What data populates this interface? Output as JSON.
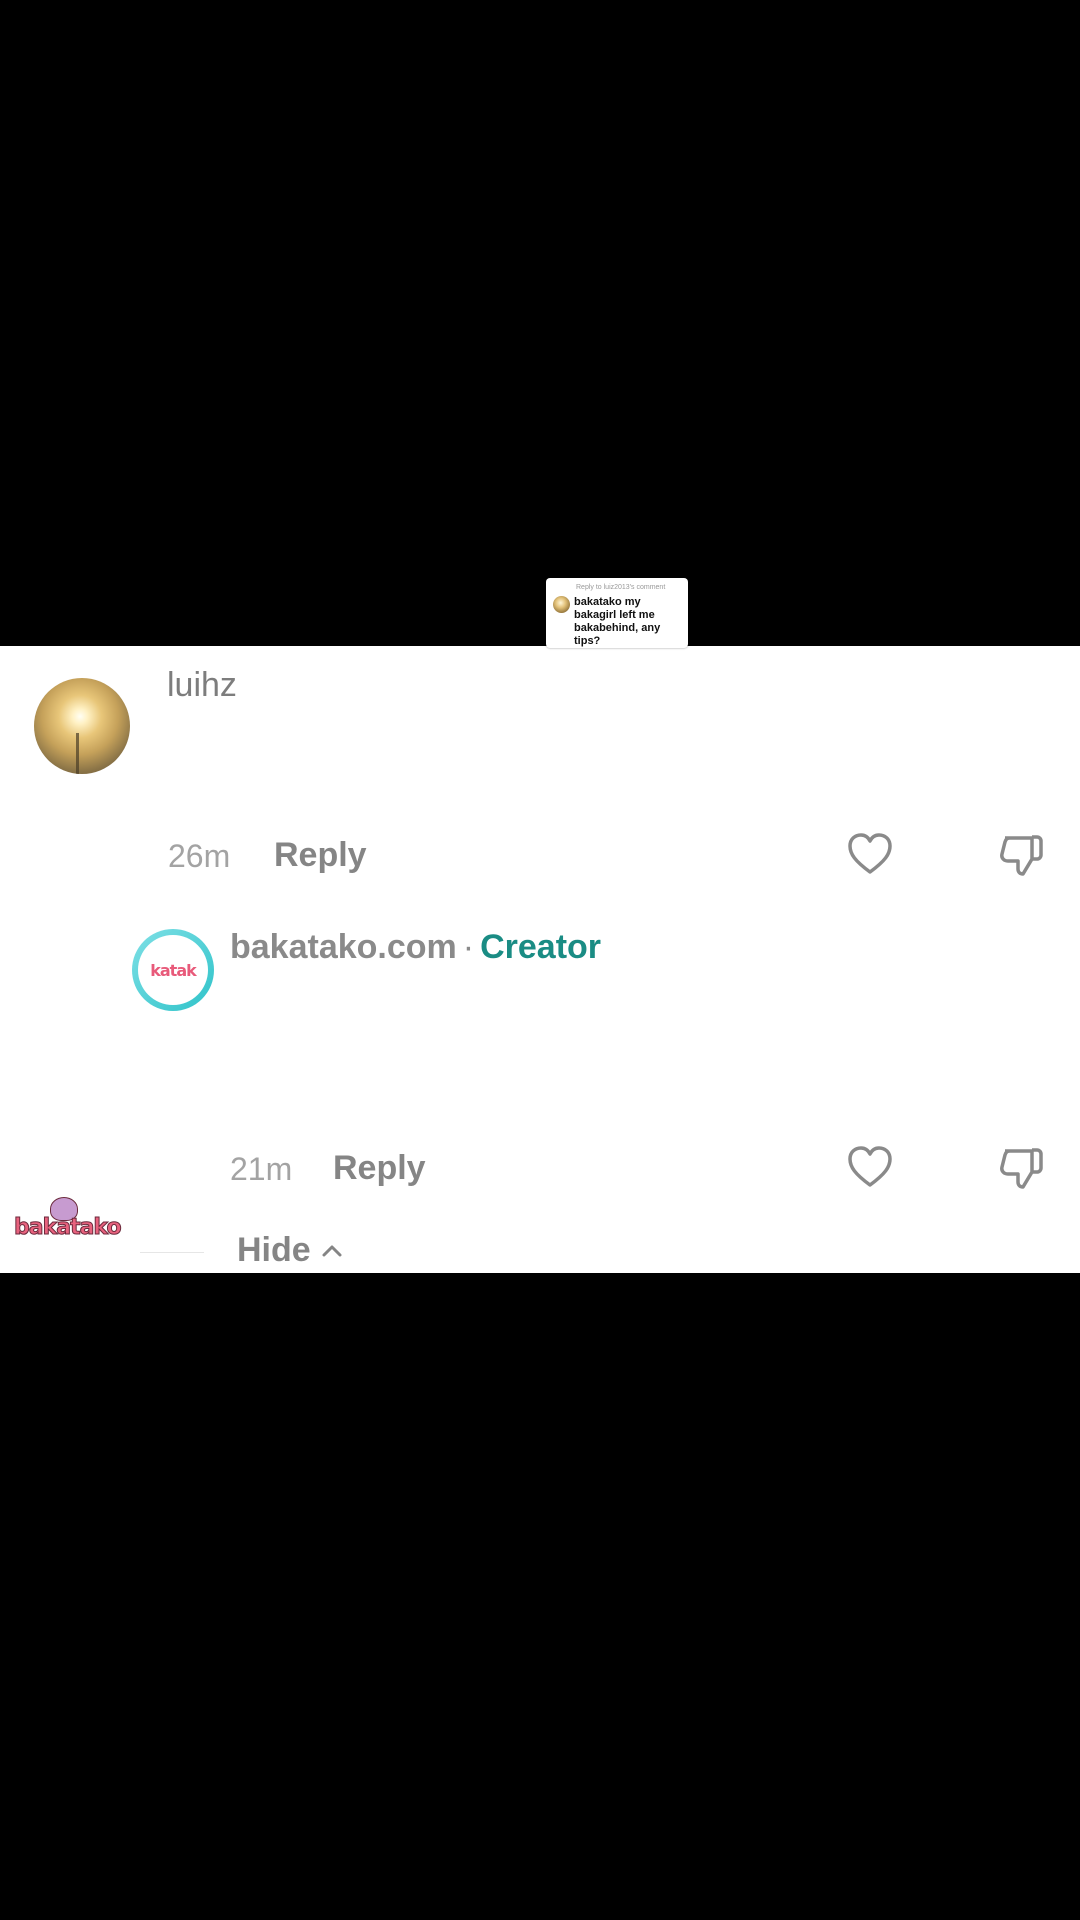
{
  "sticker": {
    "header": "Reply to luiz2013's comment",
    "body": "bakatako my bakagirl left me bakabehind, any tips?"
  },
  "comments": [
    {
      "username": "luihz",
      "time": "26m",
      "reply_label": "Reply",
      "like_icon": "heart-outline-icon",
      "dislike_icon": "thumbs-down-icon"
    },
    {
      "username": "bakatako.com",
      "separator": "·",
      "badge": "Creator",
      "time": "21m",
      "reply_label": "Reply",
      "like_icon": "heart-outline-icon",
      "dislike_icon": "thumbs-down-icon"
    }
  ],
  "hide_label": "Hide",
  "avatar_logo_text": "katak",
  "watermark_text": "bakatako",
  "colors": {
    "creator_badge": "#1a8c84",
    "muted_text": "#8a8a8a",
    "background": "#000000",
    "panel": "#ffffff"
  }
}
